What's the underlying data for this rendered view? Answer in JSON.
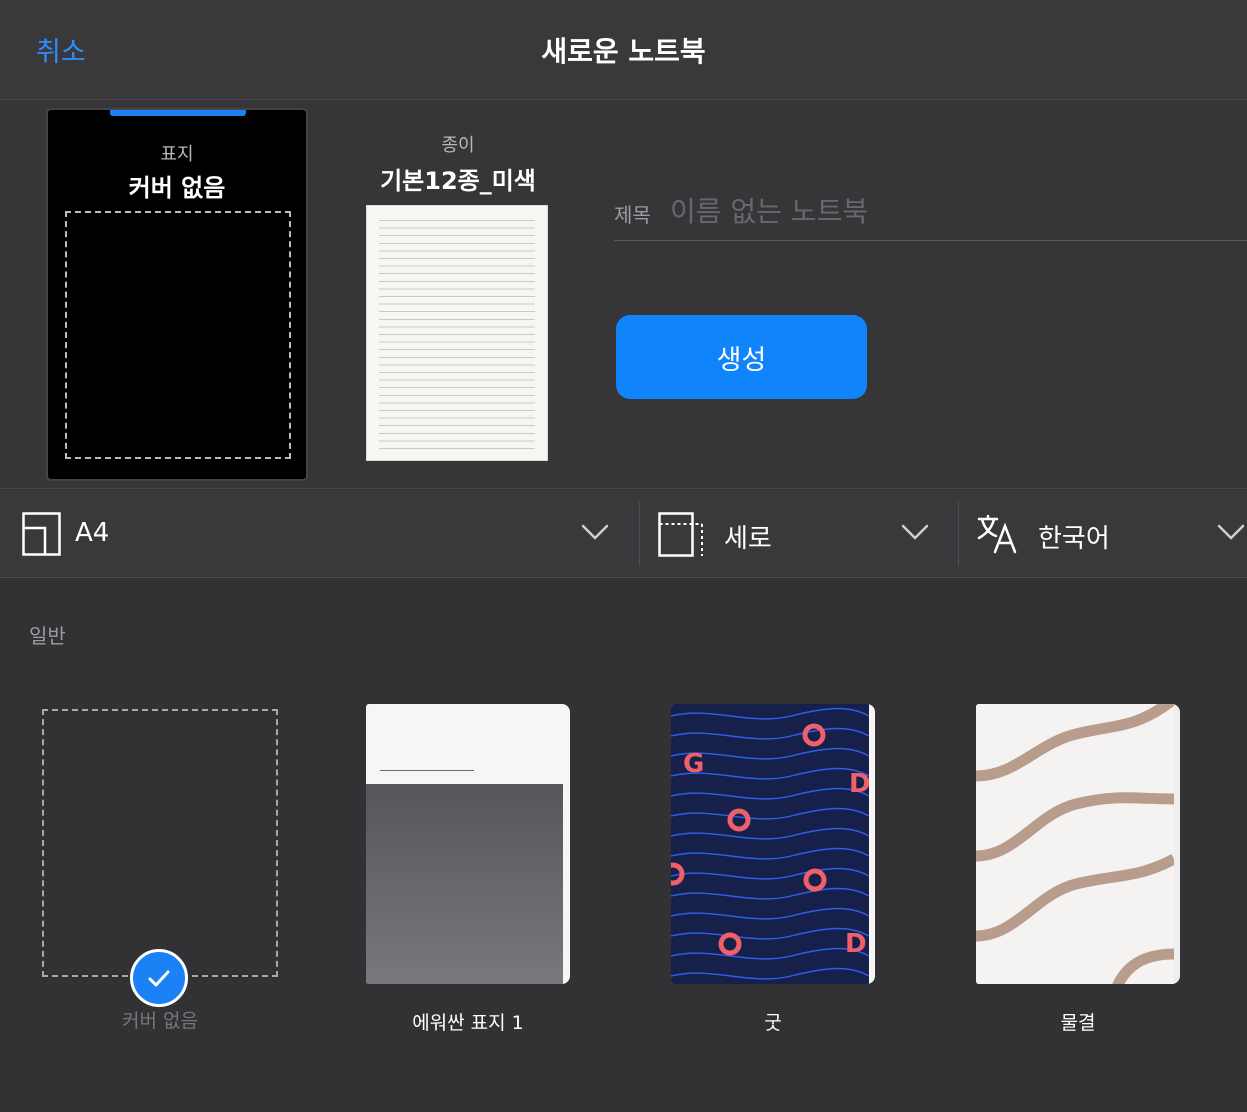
{
  "header": {
    "cancel_label": "취소",
    "title": "새로운 노트북"
  },
  "cover": {
    "caption": "표지",
    "value": "커버 없음"
  },
  "paper": {
    "caption": "종이",
    "value": "기본12종_미색"
  },
  "title_field": {
    "label": "제목",
    "placeholder": "이름 없는 노트북",
    "value": ""
  },
  "create_button": {
    "label": "생성"
  },
  "selectors": {
    "size": {
      "value": "A4",
      "icon": "page-size-icon"
    },
    "orientation": {
      "value": "세로",
      "icon": "orientation-icon"
    },
    "language": {
      "value": "한국어",
      "icon": "translate-icon"
    }
  },
  "gallery": {
    "section_label": "일반",
    "items": [
      {
        "name": "커버 없음",
        "selected": true
      },
      {
        "name": "에워싼 표지 1",
        "selected": false
      },
      {
        "name": "굿",
        "selected": false
      },
      {
        "name": "물결",
        "selected": false
      }
    ]
  },
  "colors": {
    "accent": "#0f84fb",
    "background": "#323234",
    "good_cover_bg": "#16204a",
    "good_cover_letters": "#f0606a",
    "wave_color": "#b99d8c"
  }
}
